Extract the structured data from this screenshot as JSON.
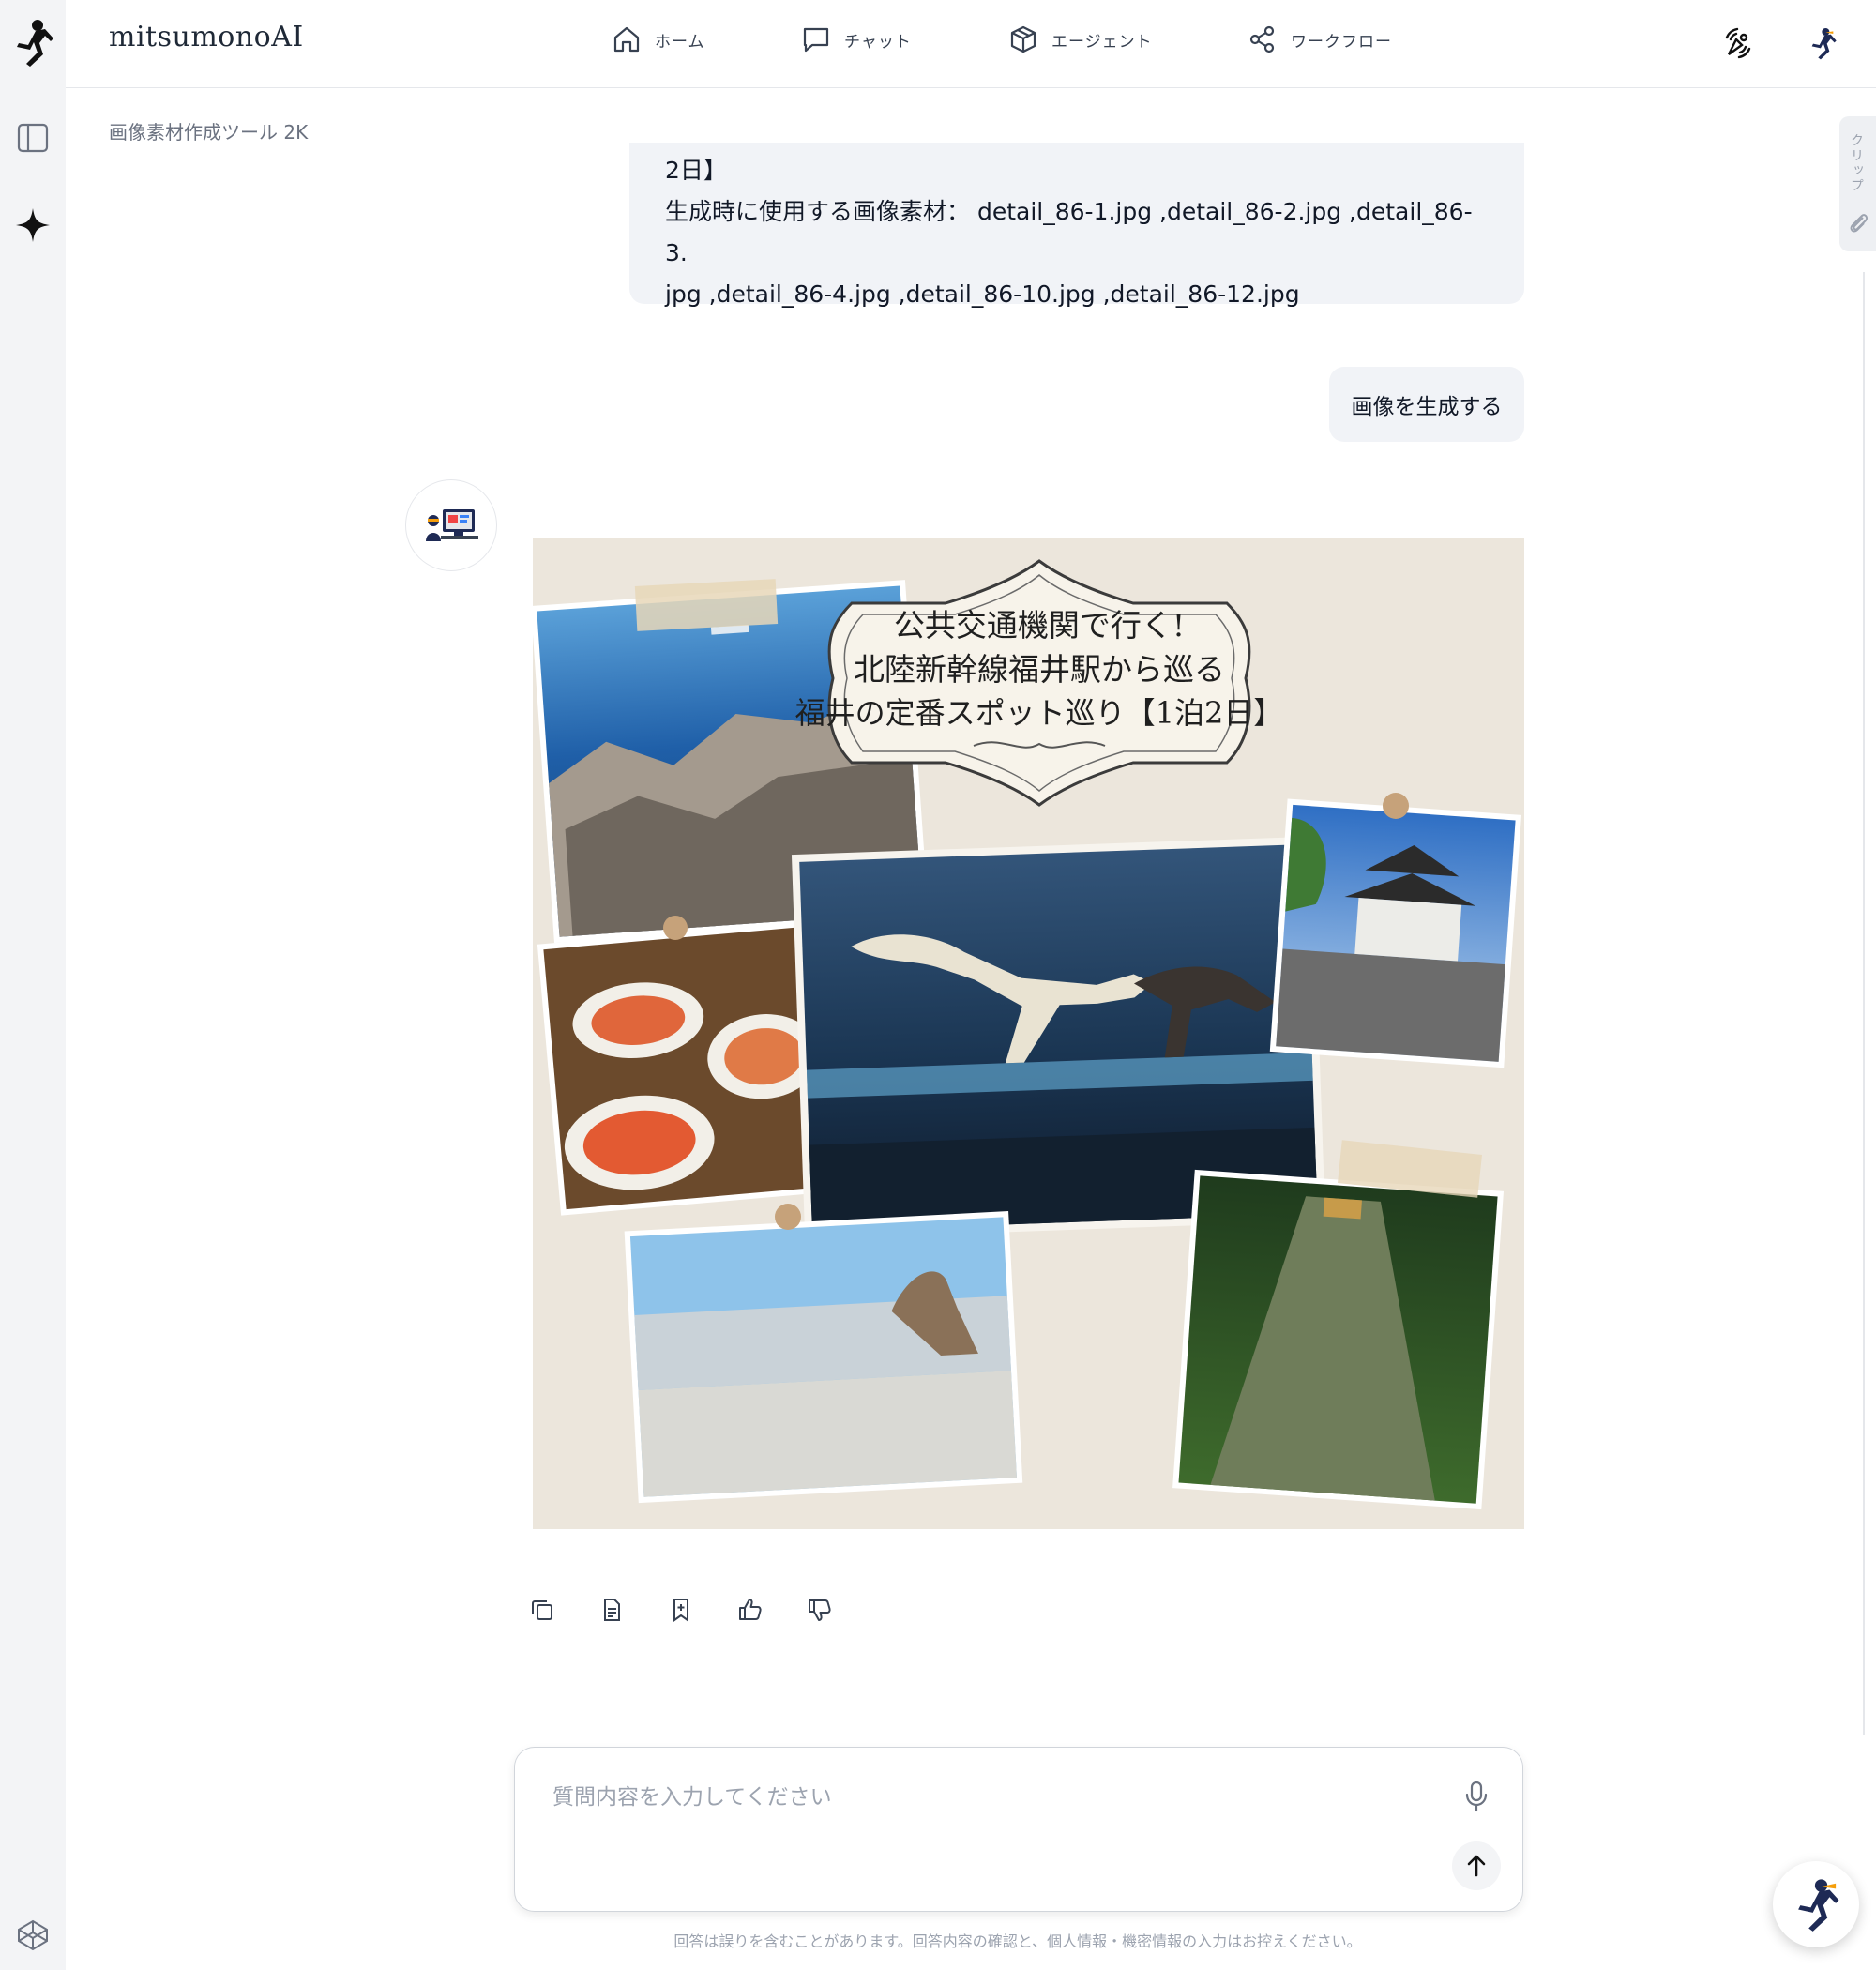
{
  "app": {
    "brand": "mitsumonoAI"
  },
  "nav": [
    {
      "label": "ホーム",
      "icon": "home-icon"
    },
    {
      "label": "チャット",
      "icon": "chat-icon"
    },
    {
      "label": "エージェント",
      "icon": "cube-icon"
    },
    {
      "label": "ワークフロー",
      "icon": "workflow-icon"
    }
  ],
  "breadcrumb": "画像素材作成ツール 2K",
  "clip_tab": "クリップ",
  "messages": {
    "user1": {
      "line1": "2日】",
      "line2": "生成時に使用する画像素材： detail_86-1.jpg ,detail_86-2.jpg ,detail_86-3.",
      "line3": "jpg ,detail_86-4.jpg ,detail_86-10.jpg ,detail_86-12.jpg"
    },
    "user2": "画像を生成する"
  },
  "generated_image": {
    "banner_line1": "公共交通機関で行く!",
    "banner_line2": "北陸新幹線福井駅から巡る",
    "banner_line3": "福井の定番スポット巡り【1泊2日】"
  },
  "actions": [
    "copy-icon",
    "document-icon",
    "bookmark-add-icon",
    "thumbs-up-icon",
    "thumbs-down-icon"
  ],
  "composer": {
    "placeholder": "質問内容を入力してください"
  },
  "disclaimer": "回答は誤りを含むことがあります。回答内容の確認と、個人情報・機密情報の入力はお控えください。",
  "colors": {
    "accent_navy": "#1e2a55",
    "bubble_bg": "#f1f3f7",
    "rail_bg": "#f3f4f6"
  }
}
